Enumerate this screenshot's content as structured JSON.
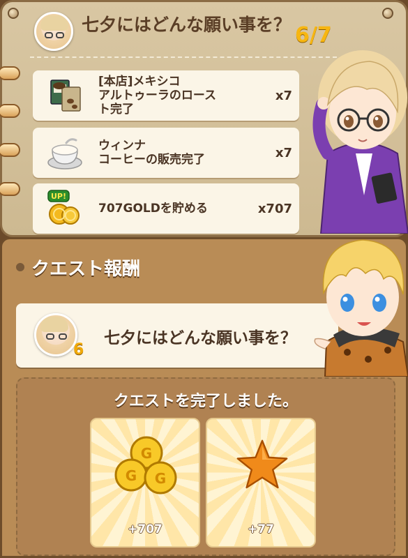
{
  "quest": {
    "title": "七夕にはどんな願い事を？",
    "progress": "6/7",
    "tasks": [
      {
        "icon": "coffee-beans-icon",
        "label": "[本店]メキシコ\nアルトゥーラのロース\nト完了",
        "count": "x7"
      },
      {
        "icon": "coffee-cup-icon",
        "label": "ウィンナ\nコーヒーの販売完了",
        "count": "x7"
      },
      {
        "icon": "gold-coins-up-icon",
        "badge": "UP!",
        "label": "707GOLDを貯める",
        "count": "x707"
      }
    ]
  },
  "rewards": {
    "title": "クエスト報酬",
    "completed_quest": {
      "name": "七夕にはどんな願い事を？",
      "level": "6"
    },
    "complete_message": "クエストを完了しました。",
    "items": [
      {
        "icon": "gold-coins-icon",
        "amount": "+707"
      },
      {
        "icon": "star-icon",
        "amount": "+77"
      }
    ]
  },
  "colors": {
    "panel_tan": "#d9c7a3",
    "reward_brown": "#b98c56",
    "progress_gold": "#f7b611",
    "card_cream": "#fbf5e7"
  }
}
